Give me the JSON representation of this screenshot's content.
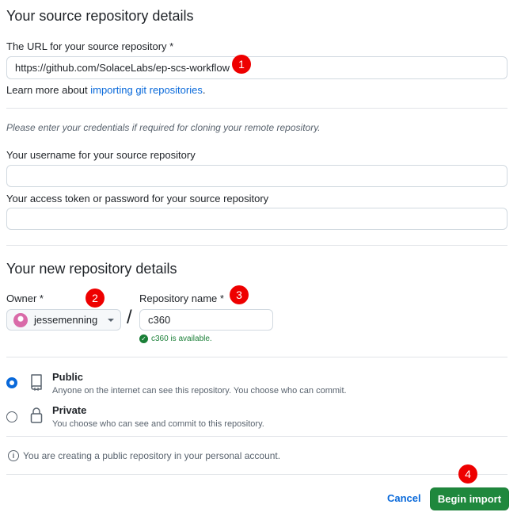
{
  "source": {
    "heading": "Your source repository details",
    "url_label": "The URL for your source repository *",
    "url_value": "https://github.com/SolaceLabs/ep-scs-workflow",
    "learn_prefix": "Learn more about ",
    "learn_link": "importing git repositories",
    "learn_suffix": ".",
    "credentials_note": "Please enter your credentials if required for cloning your remote repository.",
    "username_label": "Your username for your source repository",
    "username_value": "",
    "token_label": "Your access token or password for your source repository",
    "token_value": ""
  },
  "new_repo": {
    "heading": "Your new repository details",
    "owner_label": "Owner *",
    "owner_value": "jessemenning",
    "separator": "/",
    "name_label": "Repository name *",
    "name_value": "c360",
    "availability": "c360 is available.",
    "visibility": {
      "public_title": "Public",
      "public_desc": "Anyone on the internet can see this repository. You choose who can commit.",
      "private_title": "Private",
      "private_desc": "You choose who can see and commit to this repository.",
      "selected": "public"
    },
    "info_text": "You are creating a public repository in your personal account."
  },
  "actions": {
    "cancel": "Cancel",
    "begin_import": "Begin import"
  },
  "annotations": [
    "1",
    "2",
    "3",
    "4"
  ],
  "colors": {
    "primary_button": "#1f883d",
    "link": "#0969da",
    "success": "#1a7f37",
    "annotation_badge": "#ee0000",
    "selected_radio": "#0969da"
  }
}
